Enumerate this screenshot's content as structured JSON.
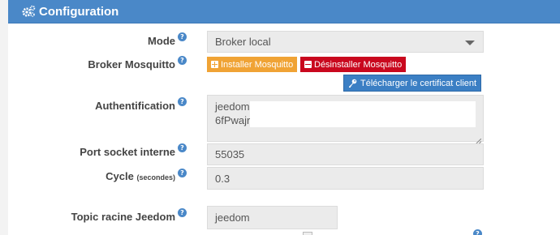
{
  "header": {
    "title": "Configuration",
    "icon": "gears-icon"
  },
  "form": {
    "mode": {
      "label": "Mode",
      "value": "Broker local"
    },
    "broker": {
      "label": "Broker Mosquitto",
      "install_label": "Installer Mosquitto",
      "uninstall_label": "Désinstaller Mosquitto",
      "download_label": "Télécharger le certificat client"
    },
    "auth": {
      "label": "Authentification",
      "line1": "jeedom",
      "line2": "6fPwajr"
    },
    "port": {
      "label": "Port socket interne",
      "value": "55035"
    },
    "cycle": {
      "label": "Cycle",
      "unit": "(secondes)",
      "value": "0.3"
    },
    "topic": {
      "label": "Topic racine Jeedom",
      "value": "jeedom"
    },
    "help_glyph": "?"
  },
  "colors": {
    "header": "#4a88c8",
    "install": "#f0a335",
    "uninstall": "#c9081e",
    "download": "#3b7fc4"
  }
}
